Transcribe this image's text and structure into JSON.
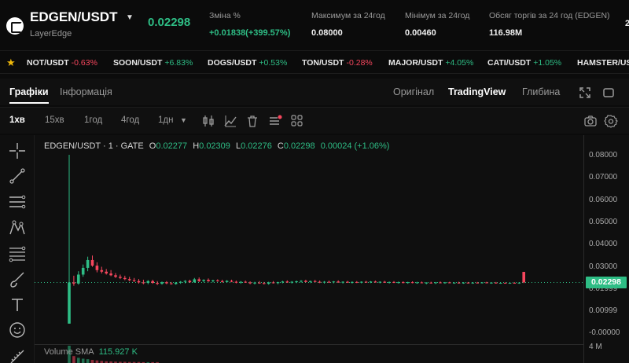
{
  "header": {
    "pair": "EDGEN/USDT",
    "subtitle": "LayerEdge",
    "last_price": "0.02298",
    "stats": [
      {
        "label": "Зміна %",
        "value": "+0.01838(+399.57%)",
        "tone": "green"
      },
      {
        "label": "Максимум за 24год",
        "value": "0.08000",
        "tone": "plain"
      },
      {
        "label": "Мінімум за 24год",
        "value": "0.00460",
        "tone": "plain"
      },
      {
        "label": "Обсяг торгів за 24 год (EDGEN)",
        "value": "116.98M",
        "tone": "plain"
      },
      {
        "label": "",
        "value": "2",
        "tone": "plain"
      }
    ]
  },
  "ticker": [
    {
      "symbol": "NOT/USDT",
      "change": "-0.63%",
      "dir": "down"
    },
    {
      "symbol": "SOON/USDT",
      "change": "+6.83%",
      "dir": "up"
    },
    {
      "symbol": "DOGS/USDT",
      "change": "+0.53%",
      "dir": "up"
    },
    {
      "symbol": "TON/USDT",
      "change": "-0.28%",
      "dir": "down"
    },
    {
      "symbol": "MAJOR/USDT",
      "change": "+4.05%",
      "dir": "up"
    },
    {
      "symbol": "CATI/USDT",
      "change": "+1.05%",
      "dir": "up"
    },
    {
      "symbol": "HAMSTER/USDT",
      "change": "",
      "dir": "up"
    }
  ],
  "tabs": {
    "charts": "Графіки",
    "info": "Інформація",
    "original": "Оригінал",
    "tradingview": "TradingView",
    "depth": "Глибина"
  },
  "timeframes": [
    "1хв",
    "15хв",
    "1год",
    "4год",
    "1дн"
  ],
  "toolbar_icons": [
    "candles-icon",
    "indicators-icon",
    "trash-icon",
    "list-alert-icon",
    "layout-grid-icon",
    "camera-icon",
    "settings-icon"
  ],
  "left_tools": [
    "crosshair-icon",
    "trendline-icon",
    "horizontal-lines-icon",
    "pattern-icon",
    "fib-icon",
    "brush-icon",
    "text-icon",
    "emoji-icon",
    "ruler-icon"
  ],
  "legend": {
    "title": "EDGEN/USDT · 1 · GATE",
    "open_k": "O",
    "open": "0.02277",
    "high_k": "H",
    "high": "0.02309",
    "low_k": "L",
    "low": "0.02276",
    "close_k": "C",
    "close": "0.02298",
    "change": "0.00024 (+1.06%)"
  },
  "volume_legend": {
    "label": "Volume SMA",
    "value": "115.927 K"
  },
  "yaxis_labels": [
    "0.08000",
    "0.07000",
    "0.06000",
    "0.05000",
    "0.04000",
    "0.03000",
    "0.01999",
    "0.00999",
    "-0.00000",
    "4 M"
  ],
  "current_price_tag": "0.02298",
  "colors": {
    "up": "#2ebd85",
    "down": "#f6465d",
    "accent": "#f0b90b"
  },
  "chart_data": {
    "type": "candlestick",
    "ylim": [
      0.0,
      0.08
    ],
    "candles": [
      {
        "o": 0.0046,
        "h": 0.08,
        "l": 0.0046,
        "c": 0.023
      },
      {
        "o": 0.023,
        "h": 0.026,
        "l": 0.0215,
        "c": 0.0225
      },
      {
        "o": 0.0225,
        "h": 0.028,
        "l": 0.022,
        "c": 0.0265
      },
      {
        "o": 0.0265,
        "h": 0.031,
        "l": 0.0255,
        "c": 0.0295
      },
      {
        "o": 0.0295,
        "h": 0.0345,
        "l": 0.028,
        "c": 0.033
      },
      {
        "o": 0.033,
        "h": 0.035,
        "l": 0.03,
        "c": 0.0305
      },
      {
        "o": 0.0305,
        "h": 0.032,
        "l": 0.0275,
        "c": 0.0285
      },
      {
        "o": 0.0285,
        "h": 0.03,
        "l": 0.027,
        "c": 0.0278
      },
      {
        "o": 0.0278,
        "h": 0.029,
        "l": 0.0265,
        "c": 0.027
      },
      {
        "o": 0.027,
        "h": 0.0285,
        "l": 0.0258,
        "c": 0.0262
      },
      {
        "o": 0.0262,
        "h": 0.0272,
        "l": 0.025,
        "c": 0.0255
      },
      {
        "o": 0.0255,
        "h": 0.0265,
        "l": 0.0245,
        "c": 0.025
      },
      {
        "o": 0.025,
        "h": 0.026,
        "l": 0.024,
        "c": 0.0245
      },
      {
        "o": 0.0245,
        "h": 0.0255,
        "l": 0.0235,
        "c": 0.024
      },
      {
        "o": 0.024,
        "h": 0.025,
        "l": 0.0232,
        "c": 0.0236
      },
      {
        "o": 0.0236,
        "h": 0.0245,
        "l": 0.0225,
        "c": 0.023
      },
      {
        "o": 0.023,
        "h": 0.0242,
        "l": 0.0222,
        "c": 0.0228
      },
      {
        "o": 0.0228,
        "h": 0.024,
        "l": 0.0222,
        "c": 0.0236
      },
      {
        "o": 0.0236,
        "h": 0.0242,
        "l": 0.0224,
        "c": 0.0228
      },
      {
        "o": 0.0228,
        "h": 0.0236,
        "l": 0.0218,
        "c": 0.0224
      },
      {
        "o": 0.0224,
        "h": 0.0234,
        "l": 0.022,
        "c": 0.0231
      },
      {
        "o": 0.0231,
        "h": 0.0236,
        "l": 0.0222,
        "c": 0.0226
      },
      {
        "o": 0.0226,
        "h": 0.0232,
        "l": 0.022,
        "c": 0.0223
      },
      {
        "o": 0.0223,
        "h": 0.0232,
        "l": 0.022,
        "c": 0.0229
      },
      {
        "o": 0.0229,
        "h": 0.0236,
        "l": 0.0224,
        "c": 0.0233
      },
      {
        "o": 0.0233,
        "h": 0.024,
        "l": 0.0226,
        "c": 0.0237
      },
      {
        "o": 0.0237,
        "h": 0.0242,
        "l": 0.0228,
        "c": 0.0231
      },
      {
        "o": 0.0231,
        "h": 0.025,
        "l": 0.0228,
        "c": 0.0244
      },
      {
        "o": 0.0244,
        "h": 0.0252,
        "l": 0.0232,
        "c": 0.0236
      },
      {
        "o": 0.0236,
        "h": 0.0244,
        "l": 0.023,
        "c": 0.0241
      },
      {
        "o": 0.0241,
        "h": 0.0248,
        "l": 0.0233,
        "c": 0.0235
      },
      {
        "o": 0.0235,
        "h": 0.0242,
        "l": 0.023,
        "c": 0.0239
      },
      {
        "o": 0.0239,
        "h": 0.0244,
        "l": 0.0233,
        "c": 0.0236
      },
      {
        "o": 0.0236,
        "h": 0.0242,
        "l": 0.0229,
        "c": 0.0232
      },
      {
        "o": 0.0232,
        "h": 0.024,
        "l": 0.0228,
        "c": 0.0237
      },
      {
        "o": 0.0237,
        "h": 0.0242,
        "l": 0.0231,
        "c": 0.0233
      },
      {
        "o": 0.0233,
        "h": 0.0238,
        "l": 0.0226,
        "c": 0.0229
      },
      {
        "o": 0.0229,
        "h": 0.0236,
        "l": 0.0224,
        "c": 0.0233
      },
      {
        "o": 0.0233,
        "h": 0.0238,
        "l": 0.0228,
        "c": 0.023
      },
      {
        "o": 0.023,
        "h": 0.0235,
        "l": 0.0222,
        "c": 0.0226
      },
      {
        "o": 0.0226,
        "h": 0.0233,
        "l": 0.0221,
        "c": 0.0229
      },
      {
        "o": 0.0229,
        "h": 0.0236,
        "l": 0.0224,
        "c": 0.0227
      },
      {
        "o": 0.0227,
        "h": 0.0232,
        "l": 0.0221,
        "c": 0.0224
      },
      {
        "o": 0.0224,
        "h": 0.0233,
        "l": 0.022,
        "c": 0.023
      },
      {
        "o": 0.023,
        "h": 0.0236,
        "l": 0.0225,
        "c": 0.0227
      },
      {
        "o": 0.0227,
        "h": 0.0233,
        "l": 0.0222,
        "c": 0.0231
      },
      {
        "o": 0.0231,
        "h": 0.0237,
        "l": 0.0226,
        "c": 0.0234
      },
      {
        "o": 0.0234,
        "h": 0.0239,
        "l": 0.0228,
        "c": 0.023
      },
      {
        "o": 0.023,
        "h": 0.0236,
        "l": 0.0225,
        "c": 0.0233
      },
      {
        "o": 0.0233,
        "h": 0.0238,
        "l": 0.0227,
        "c": 0.0235
      },
      {
        "o": 0.0235,
        "h": 0.024,
        "l": 0.0229,
        "c": 0.0237
      },
      {
        "o": 0.0237,
        "h": 0.0242,
        "l": 0.023,
        "c": 0.0232
      },
      {
        "o": 0.0232,
        "h": 0.0238,
        "l": 0.0227,
        "c": 0.0236
      },
      {
        "o": 0.0236,
        "h": 0.0241,
        "l": 0.023,
        "c": 0.0233
      },
      {
        "o": 0.0233,
        "h": 0.0238,
        "l": 0.0227,
        "c": 0.023
      },
      {
        "o": 0.023,
        "h": 0.0236,
        "l": 0.0225,
        "c": 0.0233
      },
      {
        "o": 0.0233,
        "h": 0.0238,
        "l": 0.0228,
        "c": 0.0231
      },
      {
        "o": 0.0231,
        "h": 0.0236,
        "l": 0.0226,
        "c": 0.0234
      },
      {
        "o": 0.0234,
        "h": 0.0239,
        "l": 0.0228,
        "c": 0.023
      },
      {
        "o": 0.023,
        "h": 0.0235,
        "l": 0.0225,
        "c": 0.0233
      },
      {
        "o": 0.0233,
        "h": 0.0237,
        "l": 0.0228,
        "c": 0.0229
      },
      {
        "o": 0.0229,
        "h": 0.0235,
        "l": 0.0225,
        "c": 0.0232
      },
      {
        "o": 0.0232,
        "h": 0.0236,
        "l": 0.0227,
        "c": 0.023
      },
      {
        "o": 0.023,
        "h": 0.0235,
        "l": 0.0226,
        "c": 0.0233
      },
      {
        "o": 0.0233,
        "h": 0.0237,
        "l": 0.0228,
        "c": 0.0231
      },
      {
        "o": 0.0231,
        "h": 0.0236,
        "l": 0.0227,
        "c": 0.0234
      },
      {
        "o": 0.0234,
        "h": 0.0238,
        "l": 0.0229,
        "c": 0.023
      },
      {
        "o": 0.023,
        "h": 0.0235,
        "l": 0.0226,
        "c": 0.0233
      },
      {
        "o": 0.0233,
        "h": 0.0237,
        "l": 0.0228,
        "c": 0.0229
      },
      {
        "o": 0.0229,
        "h": 0.0234,
        "l": 0.0225,
        "c": 0.0232
      },
      {
        "o": 0.0232,
        "h": 0.0236,
        "l": 0.0227,
        "c": 0.023
      },
      {
        "o": 0.023,
        "h": 0.0234,
        "l": 0.0225,
        "c": 0.0231
      },
      {
        "o": 0.0231,
        "h": 0.0235,
        "l": 0.0226,
        "c": 0.0228
      },
      {
        "o": 0.0228,
        "h": 0.0233,
        "l": 0.0224,
        "c": 0.0231
      },
      {
        "o": 0.0231,
        "h": 0.0235,
        "l": 0.0226,
        "c": 0.0229
      },
      {
        "o": 0.0229,
        "h": 0.0233,
        "l": 0.0224,
        "c": 0.023
      },
      {
        "o": 0.023,
        "h": 0.0234,
        "l": 0.0226,
        "c": 0.0227
      },
      {
        "o": 0.0227,
        "h": 0.0231,
        "l": 0.0222,
        "c": 0.0229
      },
      {
        "o": 0.0229,
        "h": 0.0233,
        "l": 0.0225,
        "c": 0.0227
      },
      {
        "o": 0.0227,
        "h": 0.0232,
        "l": 0.0223,
        "c": 0.023
      },
      {
        "o": 0.023,
        "h": 0.0234,
        "l": 0.0226,
        "c": 0.0228
      },
      {
        "o": 0.0228,
        "h": 0.0232,
        "l": 0.0224,
        "c": 0.023
      },
      {
        "o": 0.023,
        "h": 0.0233,
        "l": 0.0226,
        "c": 0.0227
      },
      {
        "o": 0.0227,
        "h": 0.0231,
        "l": 0.0224,
        "c": 0.0229
      },
      {
        "o": 0.0229,
        "h": 0.0233,
        "l": 0.0225,
        "c": 0.0227
      },
      {
        "o": 0.0227,
        "h": 0.0231,
        "l": 0.0224,
        "c": 0.0229
      },
      {
        "o": 0.0229,
        "h": 0.0232,
        "l": 0.0225,
        "c": 0.0227
      },
      {
        "o": 0.0227,
        "h": 0.0231,
        "l": 0.0224,
        "c": 0.0229
      },
      {
        "o": 0.0229,
        "h": 0.0232,
        "l": 0.0226,
        "c": 0.0228
      },
      {
        "o": 0.0228,
        "h": 0.0231,
        "l": 0.0225,
        "c": 0.023
      },
      {
        "o": 0.023,
        "h": 0.0233,
        "l": 0.0226,
        "c": 0.0227
      },
      {
        "o": 0.0227,
        "h": 0.0231,
        "l": 0.0224,
        "c": 0.0229
      },
      {
        "o": 0.0229,
        "h": 0.0232,
        "l": 0.0225,
        "c": 0.0227
      },
      {
        "o": 0.0227,
        "h": 0.023,
        "l": 0.0224,
        "c": 0.0228
      },
      {
        "o": 0.0228,
        "h": 0.0231,
        "l": 0.0225,
        "c": 0.0226
      },
      {
        "o": 0.0226,
        "h": 0.023,
        "l": 0.0224,
        "c": 0.0228
      },
      {
        "o": 0.0228,
        "h": 0.0231,
        "l": 0.0225,
        "c": 0.0227
      },
      {
        "o": 0.0227,
        "h": 0.023,
        "l": 0.0224,
        "c": 0.0229
      },
      {
        "o": 0.0277,
        "h": 0.0231,
        "l": 0.0227,
        "c": 0.023
      }
    ],
    "volumes": [
      100,
      40,
      30,
      25,
      22,
      18,
      15,
      12,
      10,
      9,
      8,
      7,
      7,
      6,
      6,
      6,
      5,
      5,
      5,
      5
    ]
  }
}
